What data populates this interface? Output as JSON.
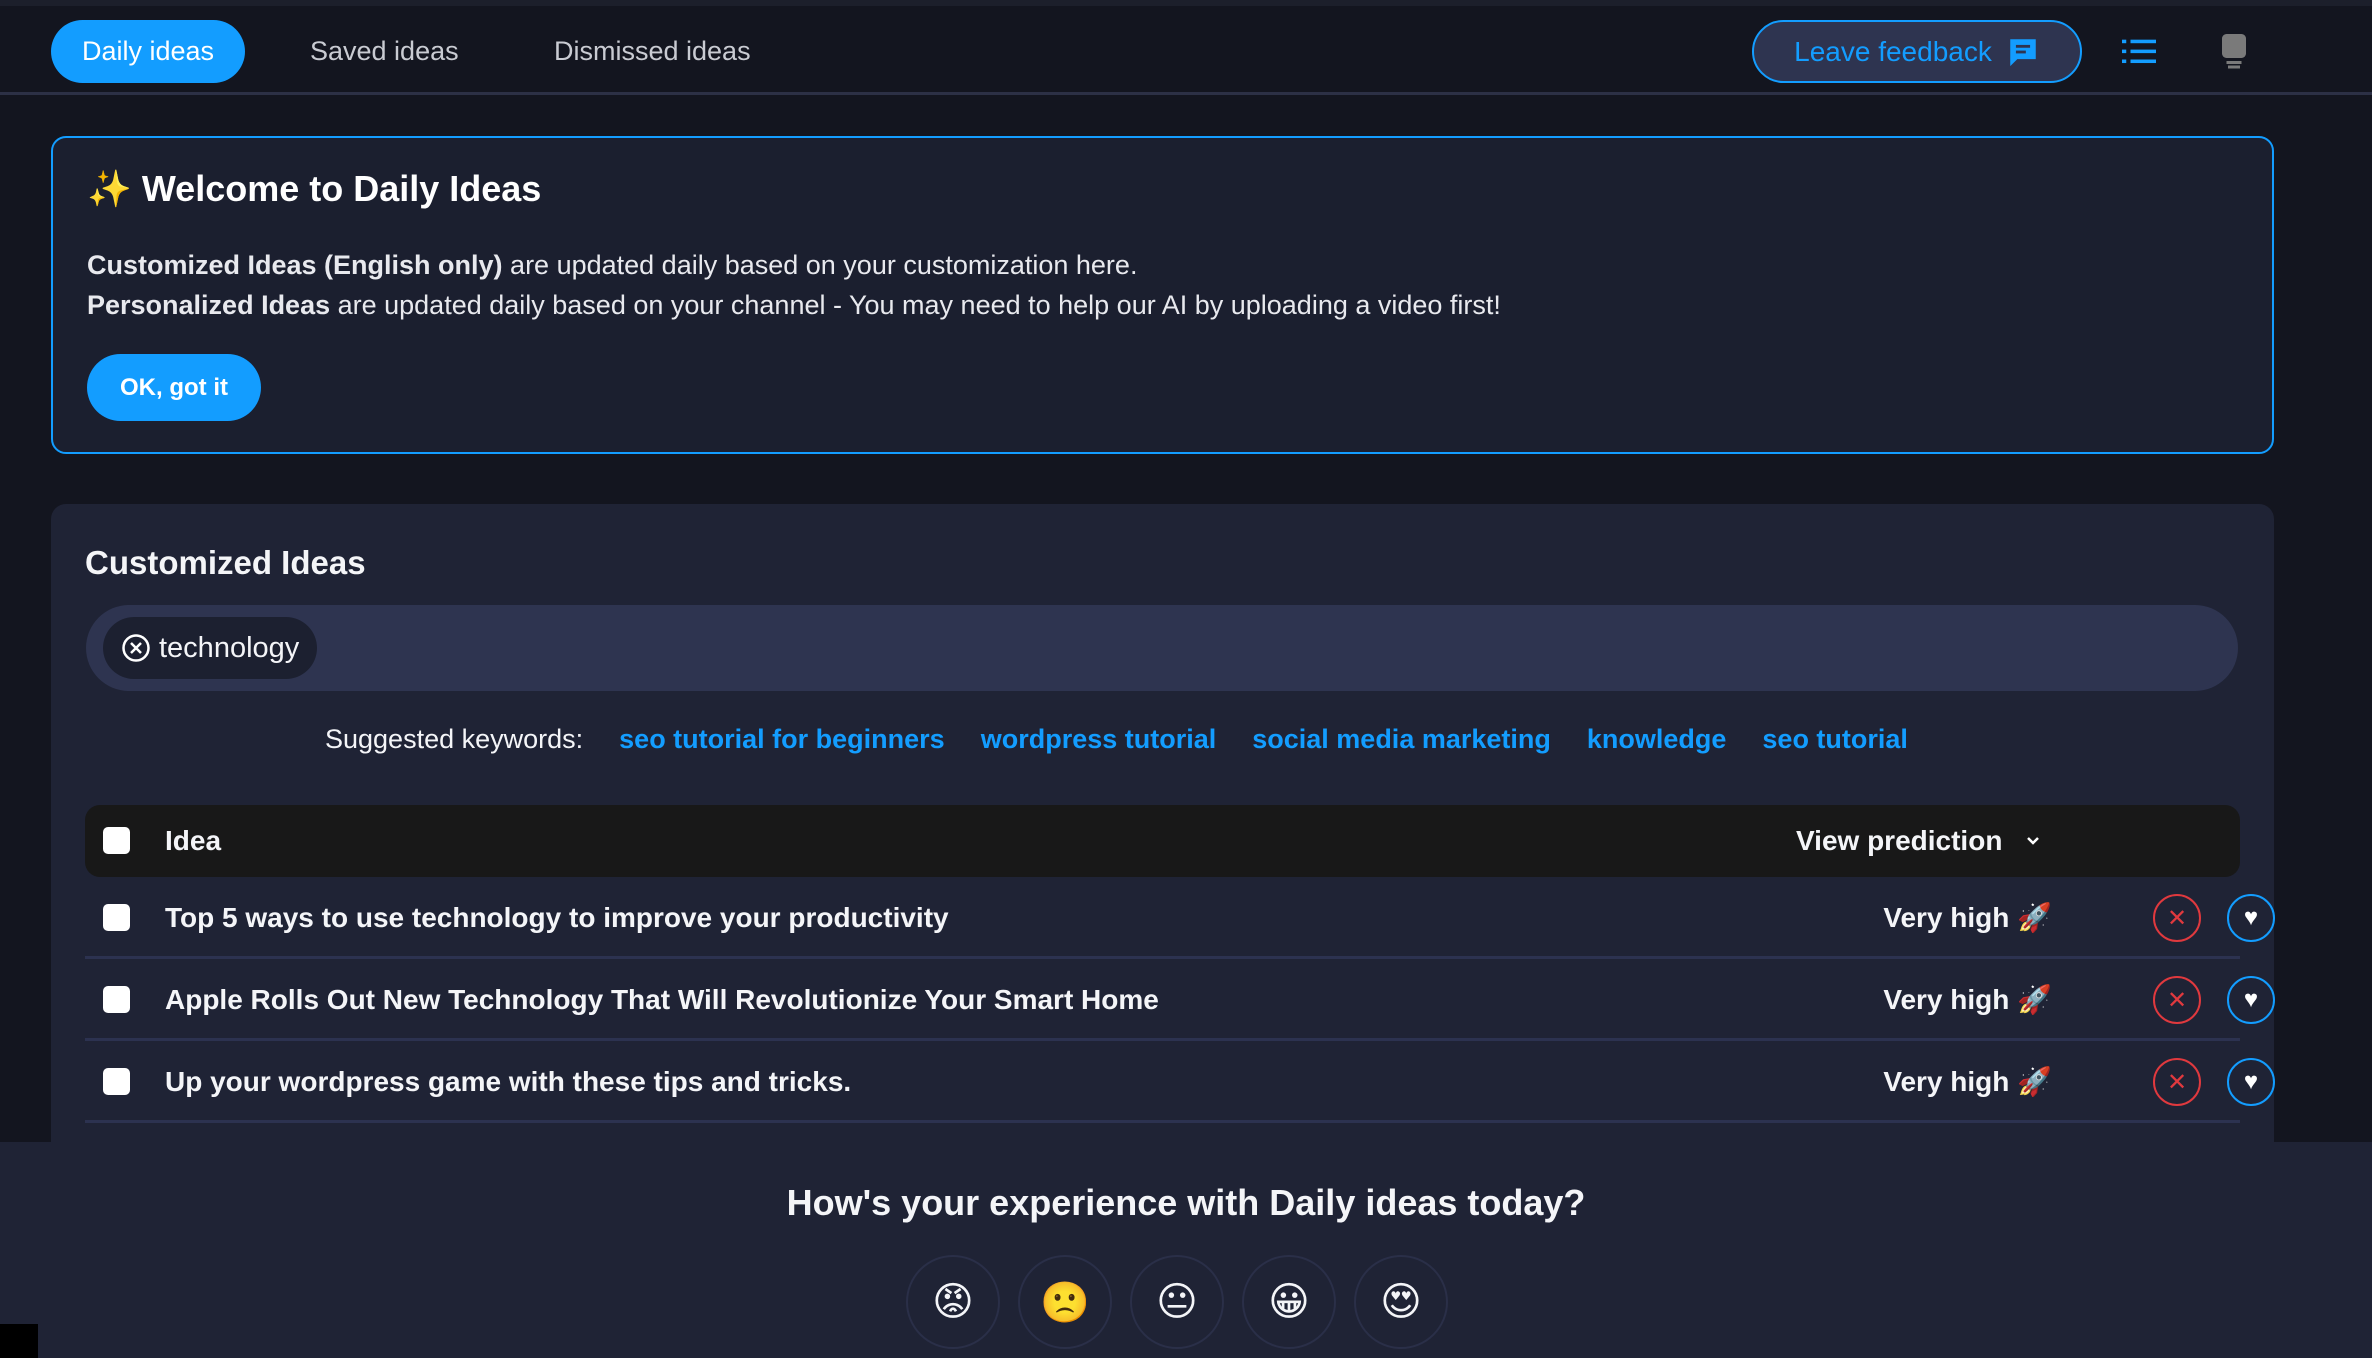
{
  "nav": {
    "tabs": [
      {
        "label": "Daily ideas",
        "active": true
      },
      {
        "label": "Saved ideas"
      },
      {
        "label": "Dismissed ideas"
      }
    ],
    "feedback_label": "Leave feedback",
    "icons": [
      "chat-icon",
      "list-icon",
      "device-icon"
    ]
  },
  "welcome": {
    "icon": "✨",
    "title": "Welcome to Daily Ideas",
    "line1_bold": "Customized Ideas (English only)",
    "line1_rest": " are updated daily based on your customization here.",
    "line2_bold": "Personalized Ideas",
    "line2_rest": " are updated daily based on your channel - You may need to help our AI by uploading a video first!",
    "ok_label": "OK, got it"
  },
  "ideas": {
    "title": "Customized Ideas",
    "chips": [
      "technology"
    ],
    "suggested_label": "Suggested keywords:",
    "suggested": [
      "seo tutorial for beginners",
      "wordpress tutorial",
      "social media marketing",
      "knowledge",
      "seo tutorial"
    ],
    "header": {
      "idea": "Idea",
      "prediction": "View prediction"
    },
    "rows": [
      {
        "title": "Top 5 ways to use technology to improve your productivity",
        "prediction": "Very high 🚀"
      },
      {
        "title": "Apple Rolls Out New Technology That Will Revolutionize Your Smart Home",
        "prediction": "Very high 🚀"
      },
      {
        "title": "Up your wordpress game with these tips and tricks.",
        "prediction": "Very high 🚀"
      }
    ]
  },
  "survey": {
    "question": "How's your experience with Daily ideas today?",
    "emojis": [
      "😡",
      "🙁",
      "😐",
      "😀",
      "😍"
    ]
  },
  "colors": {
    "accent": "#139dff",
    "dismiss": "#e0393e",
    "background": "#13151f",
    "card": "#1f2335"
  }
}
